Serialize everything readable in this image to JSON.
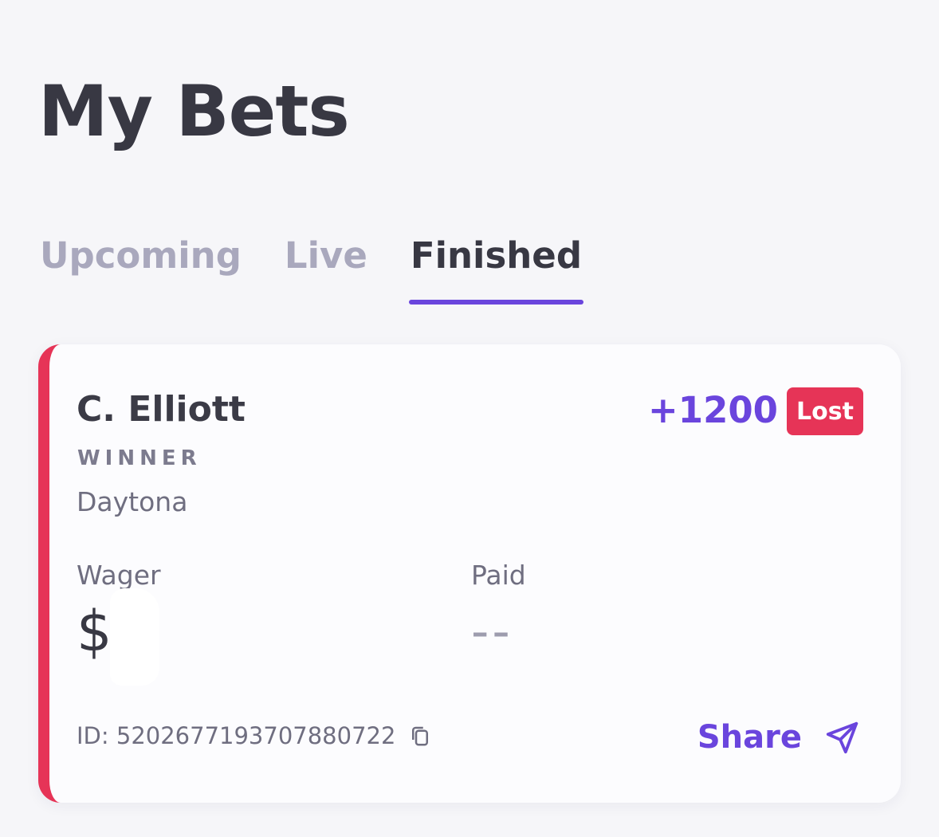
{
  "header": {
    "title": "My Bets"
  },
  "tabs": [
    {
      "label": "Upcoming"
    },
    {
      "label": "Live"
    },
    {
      "label": "Finished"
    }
  ],
  "active_tab": "Finished",
  "bet_card": {
    "selection": "C. Elliott",
    "market": "WINNER",
    "event": "Daytona",
    "odds": "+1200",
    "status": "Lost",
    "wager_label": "Wager",
    "wager_value": "$",
    "paid_label": "Paid",
    "paid_value": "--",
    "id_text": "ID: 5202677193707880722",
    "share_label": "Share"
  },
  "colors": {
    "accent": "#6a45dd",
    "lost": "#e63457",
    "background": "#f6f6f9",
    "card": "#fcfcfe"
  },
  "icons": {
    "copy": "copy-icon",
    "share": "send-icon"
  }
}
